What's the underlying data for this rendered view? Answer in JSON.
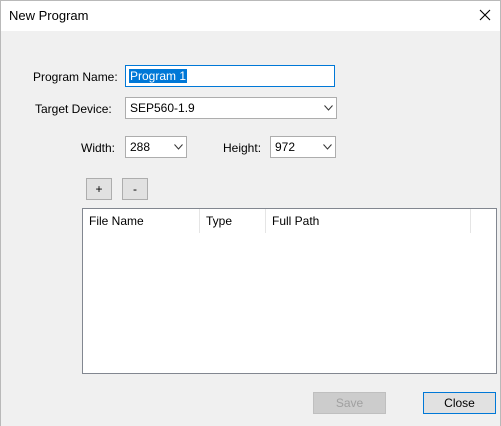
{
  "window": {
    "title": "New Program"
  },
  "form": {
    "program_name_label": "Program Name:",
    "program_name_value": "Program 1",
    "target_device_label": "Target Device:",
    "target_device_value": "SEP560-1.9",
    "width_label": "Width:",
    "width_value": "288",
    "height_label": "Height:",
    "height_value": "972"
  },
  "toolbar": {
    "add_label": "+",
    "remove_label": "-"
  },
  "file_list": {
    "columns": [
      "File Name",
      "Type",
      "Full Path"
    ],
    "rows": []
  },
  "footer": {
    "save_label": "Save",
    "close_label": "Close"
  },
  "colors": {
    "accent": "#0078d7",
    "panel": "#f0f0f0"
  },
  "icons": {
    "close": "close-icon",
    "dropdown": "chevron-down-icon"
  }
}
